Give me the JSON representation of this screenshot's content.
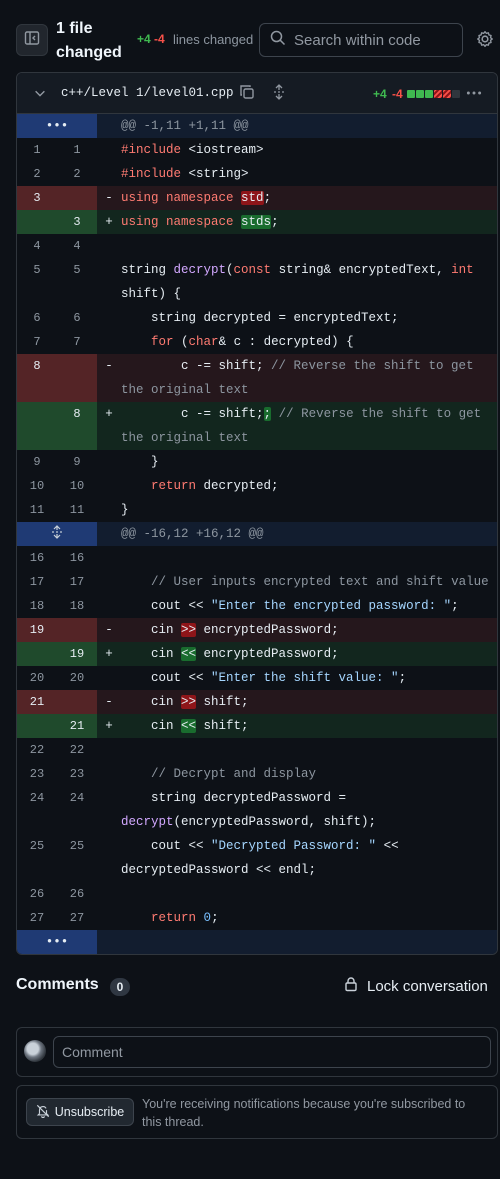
{
  "header": {
    "files_title": "1 file changed",
    "additions": "+4",
    "deletions": "-4",
    "lines_changed": "lines changed",
    "search_placeholder": "Search within code",
    "icons": [
      "sidebar-toggle-icon",
      "search-icon",
      "gear-icon"
    ]
  },
  "file": {
    "name": "c++/Level 1/level01.cpp",
    "additions": "+4",
    "deletions": "-4",
    "diffstat_blocks": [
      "add",
      "add",
      "add",
      "del",
      "del",
      "neutral"
    ],
    "colors": {
      "add": "#3fb950",
      "del": "#f85149",
      "neutral": "#30363d",
      "hunk_gutter": "#1f3a74"
    }
  },
  "hunks": [
    {
      "header": "@@ -1,11 +1,11 @@"
    },
    {
      "header": "@@ -16,12 +16,12 @@"
    }
  ],
  "comments": {
    "title": "Comments",
    "count": "0",
    "lock_label": "Lock conversation",
    "input_placeholder": "Comment",
    "unsubscribe_label": "Unsubscribe",
    "notification_text": "You're receiving notifications because you're subscribed to this thread."
  }
}
